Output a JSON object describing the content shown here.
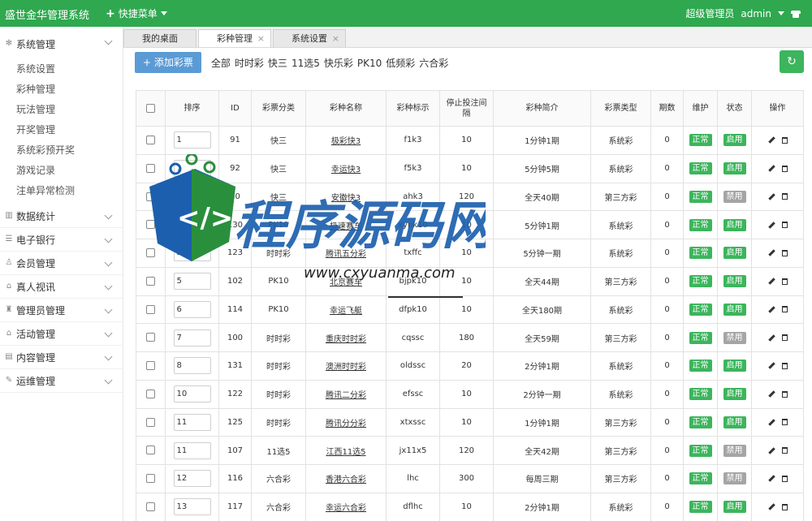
{
  "app": {
    "title": "盛世金华管理系统",
    "quick_menu": "快捷菜单"
  },
  "user": {
    "role": "超级管理员",
    "name": "admin"
  },
  "colors": {
    "brand": "#2fa84f",
    "primary_button": "#5b9bd5",
    "badge_green": "#3cb55c",
    "badge_gray": "#a5a5a5"
  },
  "sidebar": {
    "groups": [
      {
        "label": "系统管理",
        "icon": "gear-icon",
        "open": true,
        "items": [
          "系统设置",
          "彩种管理",
          "玩法管理",
          "开奖管理",
          "系统彩预开奖",
          "游戏记录",
          "注单异常检测"
        ]
      },
      {
        "label": "数据统计",
        "icon": "chart-icon"
      },
      {
        "label": "电子银行",
        "icon": "bank-icon"
      },
      {
        "label": "会员管理",
        "icon": "user-icon"
      },
      {
        "label": "真人视讯",
        "icon": "gift-icon"
      },
      {
        "label": "管理员管理",
        "icon": "admin-icon"
      },
      {
        "label": "活动管理",
        "icon": "gift-icon"
      },
      {
        "label": "内容管理",
        "icon": "content-icon"
      },
      {
        "label": "运维管理",
        "icon": "ops-icon"
      }
    ]
  },
  "tabs": [
    {
      "label": "我的桌面",
      "closable": false,
      "active": false
    },
    {
      "label": "彩种管理",
      "closable": true,
      "active": true
    },
    {
      "label": "系统设置",
      "closable": true,
      "active": false
    }
  ],
  "toolbar": {
    "add_label": "添加彩票",
    "filters": [
      "全部",
      "时时彩",
      "快三",
      "11选5",
      "快乐彩",
      "PK10",
      "低频彩",
      "六合彩"
    ]
  },
  "table": {
    "headers": [
      "排序",
      "ID",
      "彩票分类",
      "彩种名称",
      "彩种标示",
      "停止投注间隔",
      "彩种简介",
      "彩票类型",
      "期数",
      "维护",
      "状态",
      "操作"
    ],
    "rows": [
      {
        "sort": "1",
        "id": "91",
        "cat": "快三",
        "name": "极彩快3",
        "code": "f1k3",
        "stop": "10",
        "desc": "1分钟1期",
        "type": "系统彩",
        "periods": "0",
        "maint": "正常",
        "status": "启用"
      },
      {
        "sort": "1",
        "id": "92",
        "cat": "快三",
        "name": "幸运快3",
        "code": "f5k3",
        "stop": "10",
        "desc": "5分钟5期",
        "type": "系统彩",
        "periods": "0",
        "maint": "正常",
        "status": "启用"
      },
      {
        "sort": "2",
        "id": "80",
        "cat": "快三",
        "name": "安徽快3",
        "code": "ahk3",
        "stop": "120",
        "desc": "全天40期",
        "type": "第三方彩",
        "periods": "0",
        "maint": "正常",
        "status": "禁用"
      },
      {
        "sort": "3",
        "id": "130",
        "cat": "PK10",
        "name": "极速赛车",
        "code": "xypk10",
        "stop": "10",
        "desc": "5分钟1期",
        "type": "系统彩",
        "periods": "0",
        "maint": "正常",
        "status": "启用"
      },
      {
        "sort": "3",
        "id": "123",
        "cat": "时时彩",
        "name": "腾讯五分彩",
        "code": "txffc",
        "stop": "10",
        "desc": "5分钟一期",
        "type": "系统彩",
        "periods": "0",
        "maint": "正常",
        "status": "启用"
      },
      {
        "sort": "5",
        "id": "102",
        "cat": "PK10",
        "name": "北京赛车",
        "code": "bjpk10",
        "stop": "10",
        "desc": "全天44期",
        "type": "第三方彩",
        "periods": "0",
        "maint": "正常",
        "status": "启用"
      },
      {
        "sort": "6",
        "id": "114",
        "cat": "PK10",
        "name": "幸运飞艇",
        "code": "dfpk10",
        "stop": "10",
        "desc": "全天180期",
        "type": "系统彩",
        "periods": "0",
        "maint": "正常",
        "status": "启用"
      },
      {
        "sort": "7",
        "id": "100",
        "cat": "时时彩",
        "name": "重庆时时彩",
        "code": "cqssc",
        "stop": "180",
        "desc": "全天59期",
        "type": "第三方彩",
        "periods": "0",
        "maint": "正常",
        "status": "禁用"
      },
      {
        "sort": "8",
        "id": "131",
        "cat": "时时彩",
        "name": "澳洲时时彩",
        "code": "oldssc",
        "stop": "20",
        "desc": "2分钟1期",
        "type": "系统彩",
        "periods": "0",
        "maint": "正常",
        "status": "启用"
      },
      {
        "sort": "10",
        "id": "122",
        "cat": "时时彩",
        "name": "腾讯二分彩",
        "code": "efssc",
        "stop": "10",
        "desc": "2分钟一期",
        "type": "系统彩",
        "periods": "0",
        "maint": "正常",
        "status": "启用"
      },
      {
        "sort": "11",
        "id": "125",
        "cat": "时时彩",
        "name": "腾讯分分彩",
        "code": "xtxssc",
        "stop": "10",
        "desc": "1分钟1期",
        "type": "第三方彩",
        "periods": "0",
        "maint": "正常",
        "status": "启用"
      },
      {
        "sort": "11",
        "id": "107",
        "cat": "11选5",
        "name": "江西11选5",
        "code": "jx11x5",
        "stop": "120",
        "desc": "全天42期",
        "type": "第三方彩",
        "periods": "0",
        "maint": "正常",
        "status": "禁用"
      },
      {
        "sort": "12",
        "id": "116",
        "cat": "六合彩",
        "name": "香港六合彩",
        "code": "lhc",
        "stop": "300",
        "desc": "每周三期",
        "type": "第三方彩",
        "periods": "0",
        "maint": "正常",
        "status": "禁用"
      },
      {
        "sort": "13",
        "id": "117",
        "cat": "六合彩",
        "name": "幸运六合彩",
        "code": "dflhc",
        "stop": "10",
        "desc": "2分钟1期",
        "type": "系统彩",
        "periods": "0",
        "maint": "正常",
        "status": "启用"
      }
    ]
  },
  "watermark": {
    "text": "程序源码网",
    "url": "www.cxyuanma.com"
  }
}
